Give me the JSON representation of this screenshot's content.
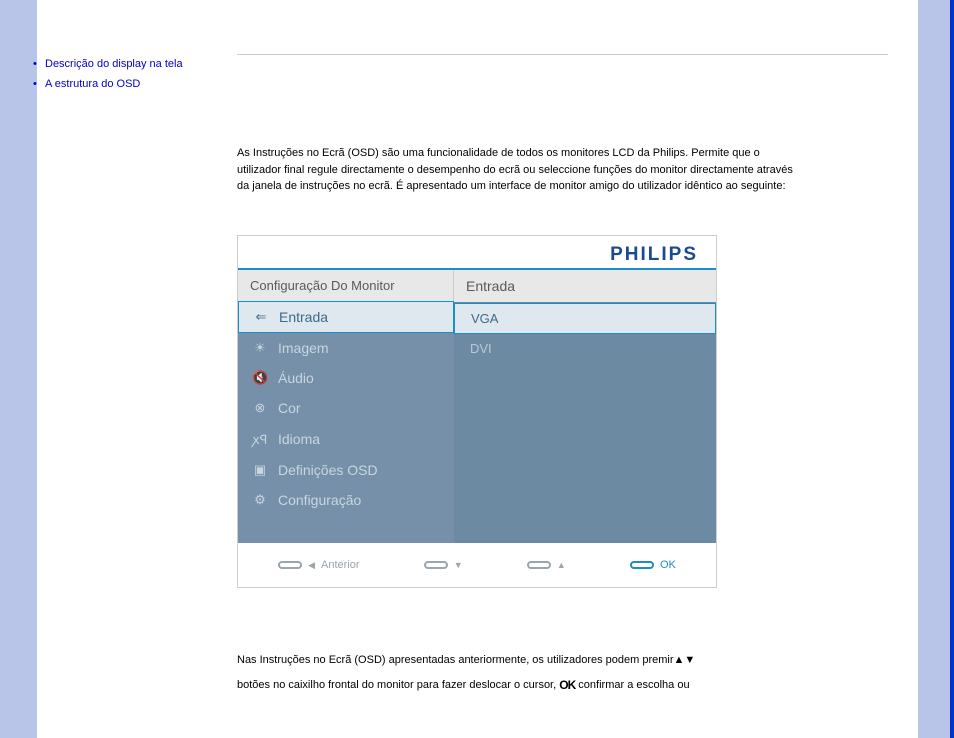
{
  "sidebar": {
    "links": [
      {
        "label": "Descrição do display na tela"
      },
      {
        "label": "A estrutura do OSD"
      }
    ]
  },
  "intro": "As Instruções no Ecrã (OSD) são uma funcionalidade de todos os monitores LCD da Philips. Permite que o utilizador final regule directamente o desempenho do ecrã ou seleccione funções do monitor directamente através da janela de instruções no ecrã. É apresentado um interface de monitor amigo do utilizador idêntico ao seguinte:",
  "osd": {
    "brand": "PHILIPS",
    "headerLeft": "Configuração Do Monitor",
    "headerRight": "Entrada",
    "menu": [
      {
        "icon": "⇐",
        "label": "Entrada",
        "selected": true
      },
      {
        "icon": "☀",
        "label": "Imagem"
      },
      {
        "icon": "🔇",
        "label": "Áudio"
      },
      {
        "icon": "⊗",
        "label": "Cor"
      },
      {
        "icon": "ꭗꟼ",
        "label": "Idioma"
      },
      {
        "icon": "▣",
        "label": "Definições OSD"
      },
      {
        "icon": "⚙",
        "label": "Configuração"
      }
    ],
    "options": [
      {
        "label": "VGA",
        "selected": true
      },
      {
        "label": "DVI"
      }
    ],
    "footer": {
      "prev": "Anterior",
      "ok": "OK"
    }
  },
  "footerText": {
    "line1a": "Nas Instruções no Ecrã (OSD) apresentadas anteriormente, os utilizadores podem premir",
    "line2a": "botões no caixilho frontal do monitor para fazer deslocar o cursor,",
    "line2b": "confirmar a escolha ou"
  }
}
